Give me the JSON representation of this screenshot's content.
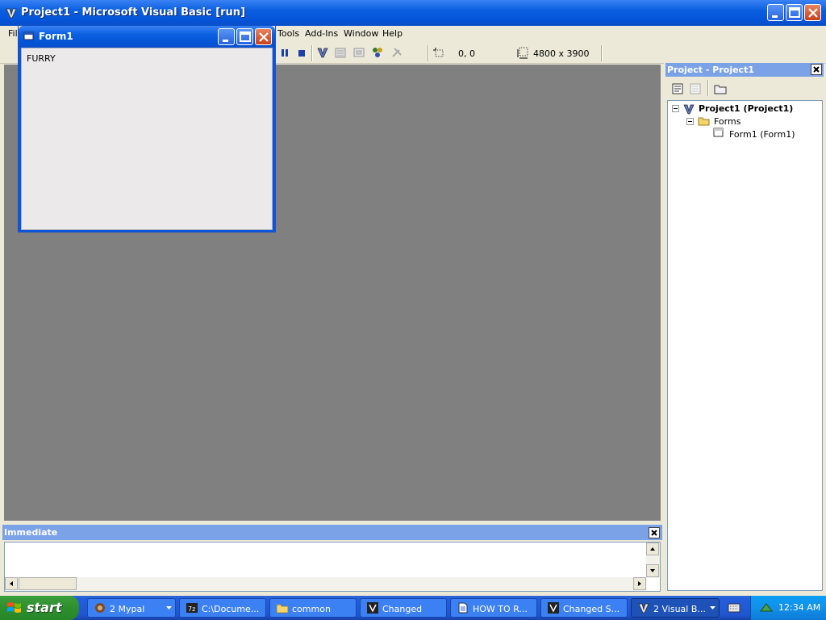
{
  "titlebar": {
    "title": "Project1 - Microsoft Visual Basic [run]"
  },
  "menubar": {
    "file_fragment": "Fil",
    "items": [
      {
        "label": "Tools"
      },
      {
        "label": "Add-Ins"
      },
      {
        "label": "Window"
      },
      {
        "label": "Help"
      }
    ]
  },
  "toolbar": {
    "position": "0, 0",
    "size": "4800 x 3900"
  },
  "form1": {
    "title": "Form1",
    "label": "FURRY"
  },
  "project": {
    "title": "Project - Project1",
    "tree": {
      "root": "Project1 (Project1)",
      "folder": "Forms",
      "leaf": "Form1 (Form1)"
    }
  },
  "immediate": {
    "title": "Immediate"
  },
  "taskbar": {
    "start_label": "start",
    "tasks": [
      {
        "label": "2 Mypal"
      },
      {
        "label": "C:\\Docume..."
      },
      {
        "label": "common"
      },
      {
        "label": "Changed"
      },
      {
        "label": "HOW TO R..."
      },
      {
        "label": "Changed S..."
      },
      {
        "label": "2 Visual B..."
      }
    ],
    "clock": "12:34 AM"
  },
  "colors": {
    "title_blue": "#0a5fe0",
    "mdi_gray": "#808080",
    "panel_header": "#7ba2e7",
    "start_green": "#2f8e2f"
  }
}
